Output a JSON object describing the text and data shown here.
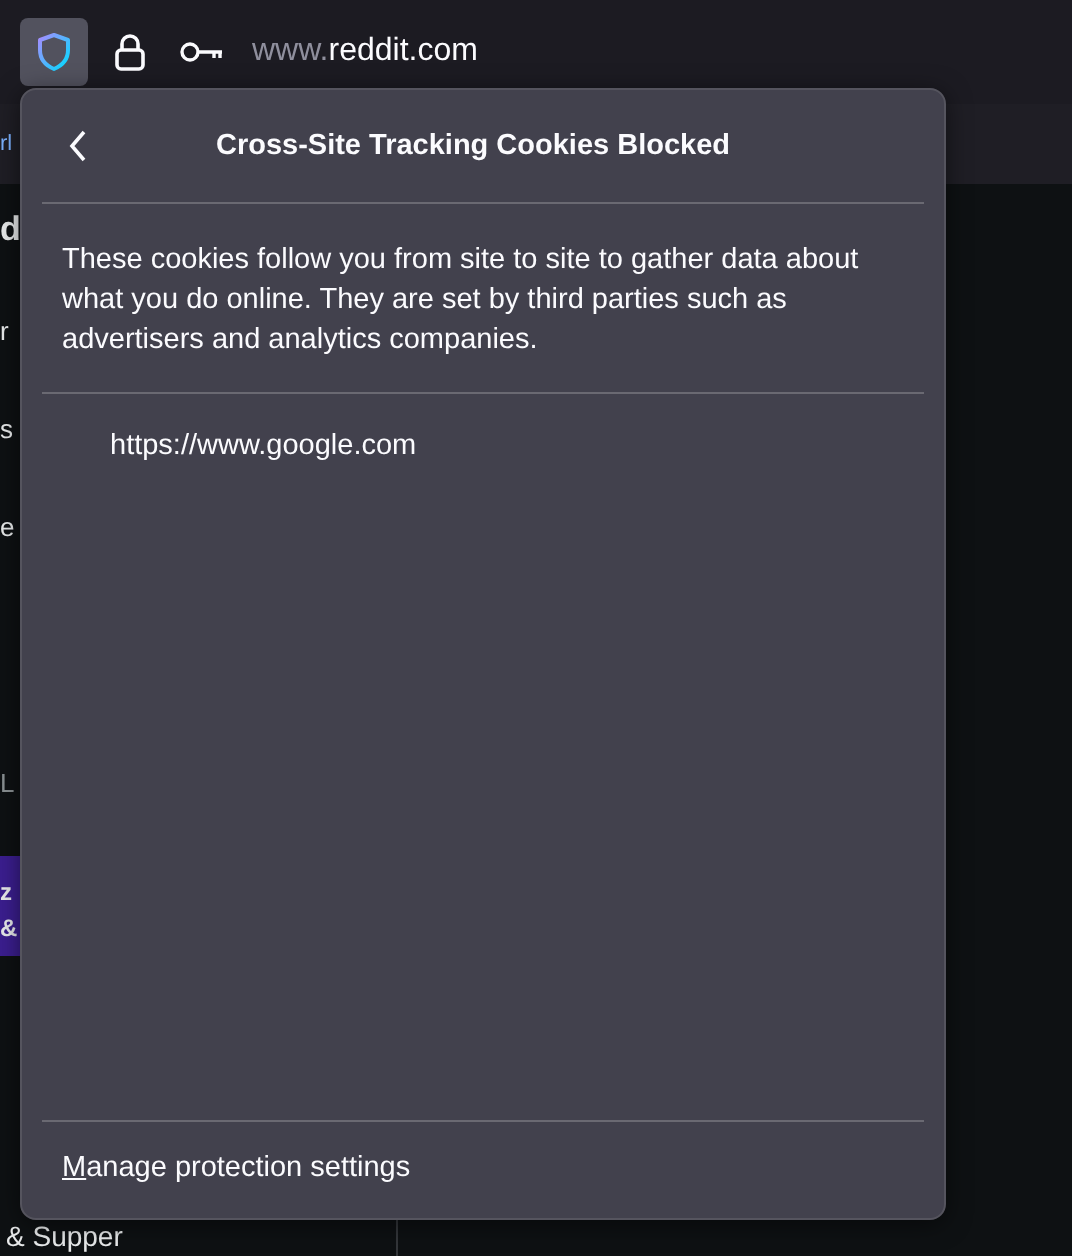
{
  "toolbar": {
    "shield_active": true,
    "url_prefix": "www.",
    "url_domain": "reddit.com"
  },
  "background_page": {
    "bookmark_fragment": "rl",
    "fragments": [
      {
        "kind": "logo",
        "text": "d"
      },
      {
        "kind": "nav",
        "text": "r"
      },
      {
        "kind": "nav",
        "text": "s"
      },
      {
        "kind": "nav",
        "text": "e"
      },
      {
        "kind": "heading",
        "text": "L"
      },
      {
        "kind": "card",
        "text": "z"
      },
      {
        "kind": "card",
        "text": "&"
      }
    ],
    "footer_fragment": "& Supper"
  },
  "popup": {
    "title": "Cross-Site Tracking Cookies Blocked",
    "description": "These cookies follow you from site to site to gather data about what you do online. They are set by third parties such as advertisers and analytics companies.",
    "sites": [
      "https://www.google.com"
    ],
    "link": "Manage protection settings"
  }
}
